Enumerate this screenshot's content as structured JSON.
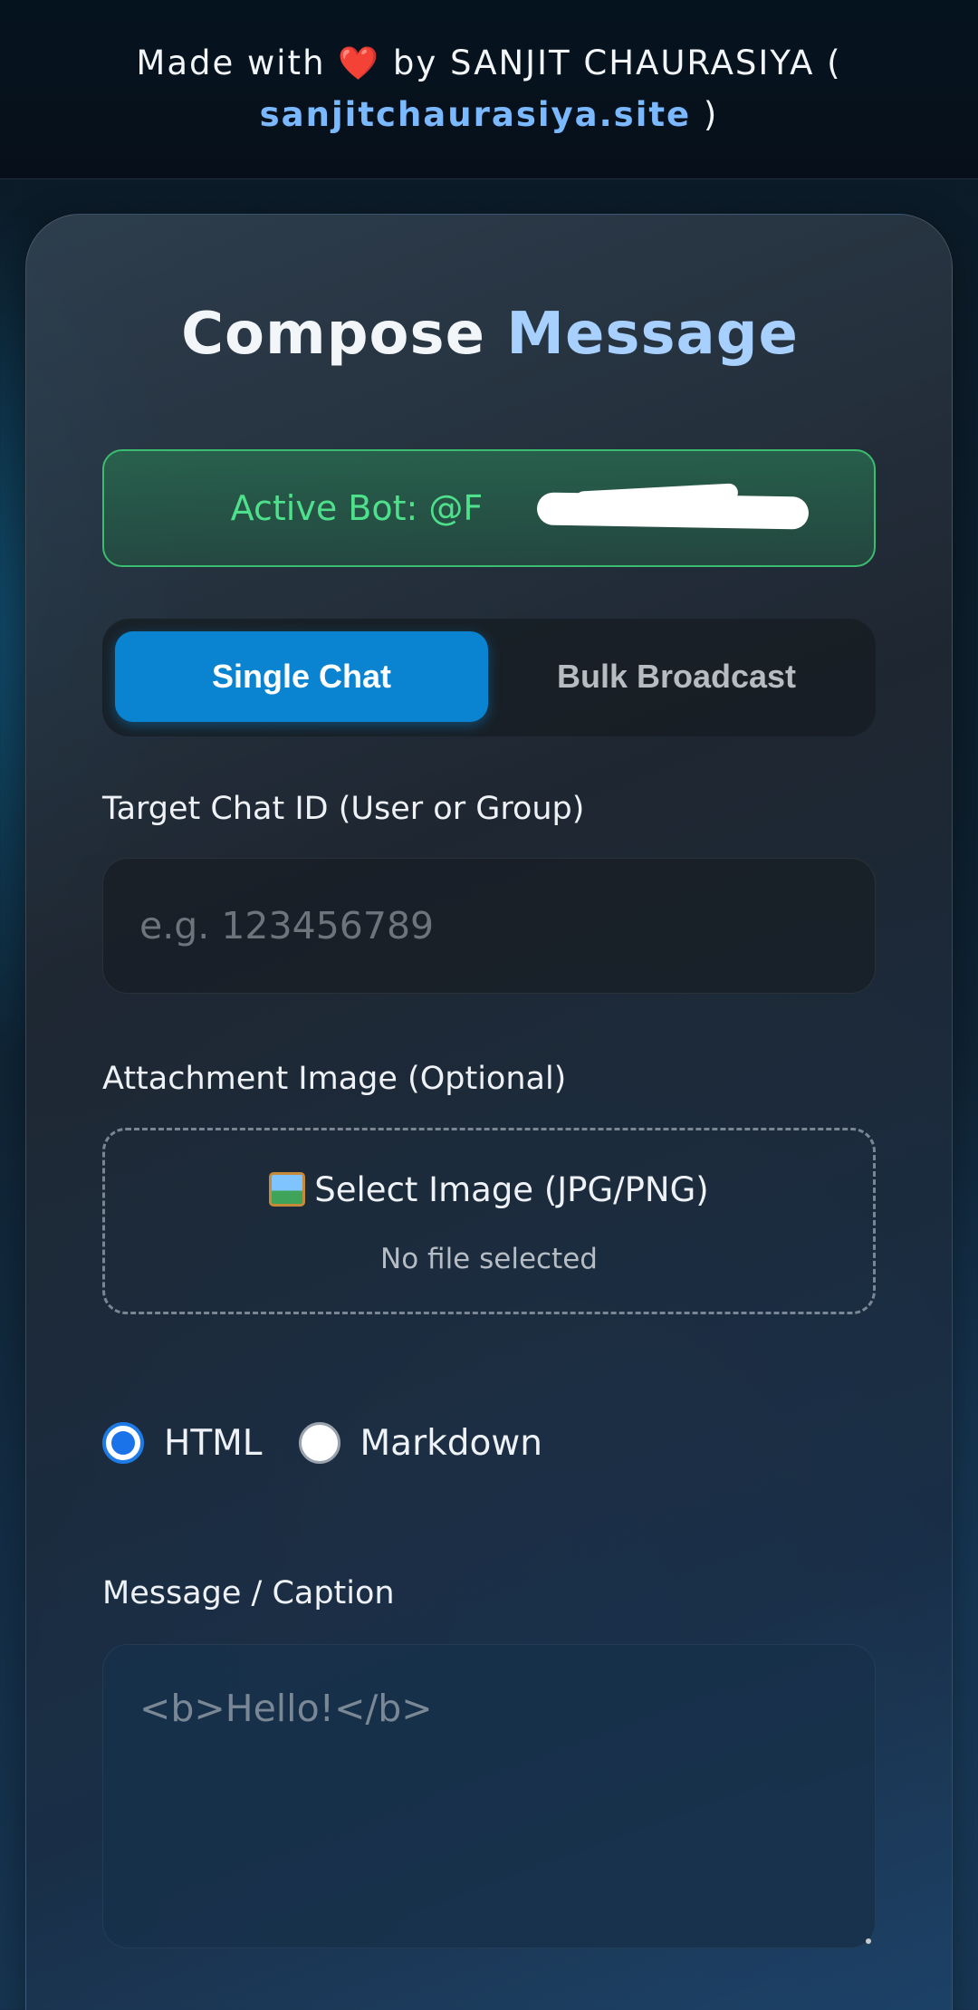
{
  "header": {
    "made_with": "Made with",
    "heart": "❤️",
    "by_author": "by SANJIT CHAURASIYA (",
    "site": "sanjitchaurasiya.site",
    "close_paren": ")"
  },
  "card": {
    "title_part1": "Compose",
    "title_part2": "Message",
    "active_bot_label": "Active Bot: @F",
    "mode_tabs": [
      {
        "label": "Single Chat",
        "active": true
      },
      {
        "label": "Bulk Broadcast",
        "active": false
      }
    ],
    "chat_id_label": "Target Chat ID (User or Group)",
    "chat_id_placeholder": "e.g. 123456789",
    "attachment_label": "Attachment Image (Optional)",
    "select_image_label": "Select Image (JPG/PNG)",
    "no_file_text": "No file selected",
    "parse_modes": [
      {
        "label": "HTML",
        "checked": true
      },
      {
        "label": "Markdown",
        "checked": false
      }
    ],
    "message_label": "Message / Caption",
    "message_placeholder": "<b>Hello!</b>"
  },
  "colors": {
    "accent": "#0a84d0",
    "link": "#7ab8ff",
    "title_accent": "#a8d0ff",
    "success": "#4ee08a"
  }
}
